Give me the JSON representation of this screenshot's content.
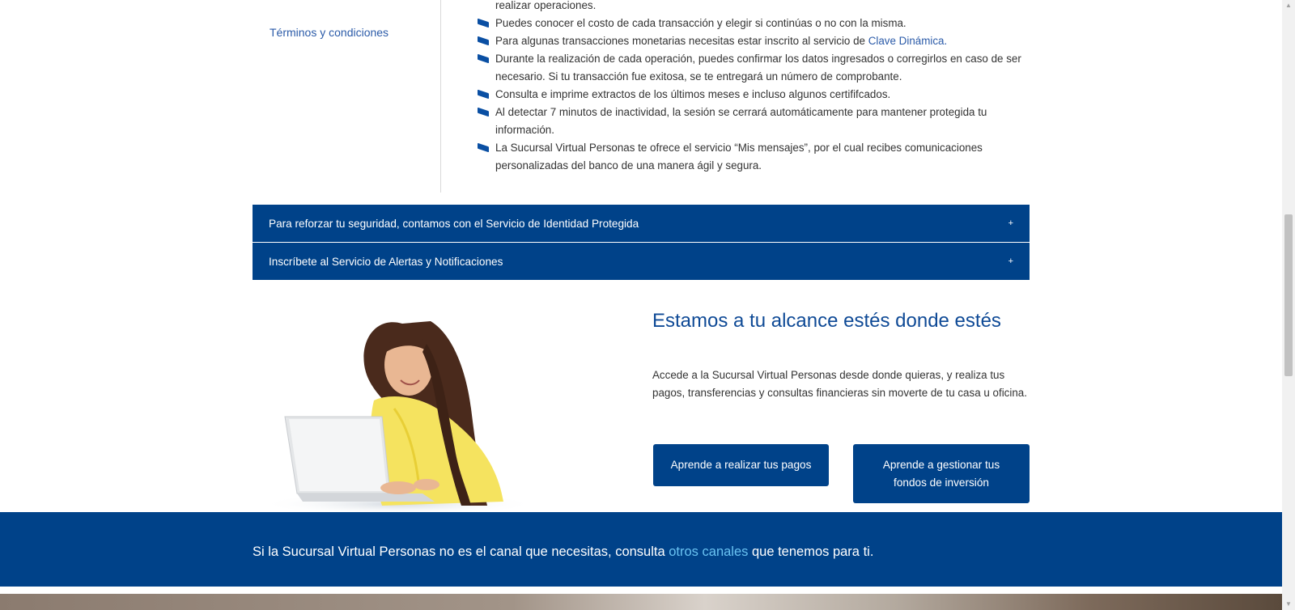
{
  "sidebar": {
    "terms_link": "Términos y condiciones"
  },
  "features": {
    "items": [
      {
        "text": "realizar operaciones."
      },
      {
        "text": "Puedes conocer el costo de cada transacción y elegir si continúas o no con la misma."
      },
      {
        "text_before": "Para algunas transacciones monetarias necesitas estar inscrito  al servicio de ",
        "link": "Clave Dinámica."
      },
      {
        "text": "Durante la realización de cada operación, puedes confirmar los datos ingresados o corregirlos en caso de ser necesario. Si tu transacción fue exitosa, se te entregará un número de comprobante."
      },
      {
        "text": "Consulta e imprime extractos de los últimos meses e incluso algunos certififcados."
      },
      {
        "text": "Al detectar 7 minutos de inactividad, la sesión se cerrará automáticamente para mantener protegida tu información."
      },
      {
        "text": "La Sucursal Virtual Personas te ofrece el servicio “Mis mensajes”, por el cual recibes comunicaciones personalizadas del banco de una manera ágil y segura."
      }
    ]
  },
  "accordions": [
    {
      "label": "Para reforzar tu seguridad, contamos con el Servicio de Identidad Protegida",
      "icon": "+"
    },
    {
      "label": "Inscríbete al Servicio de Alertas y Notificaciones",
      "icon": "+"
    }
  ],
  "hero": {
    "title": "Estamos a tu alcance estés donde estés",
    "text": "Accede a la Sucursal Virtual Personas desde donde quieras, y realiza tus pagos, transferencias y consultas financieras sin moverte de tu casa u oficina.",
    "button_pagos": "Aprende a realizar tus pagos",
    "button_fondos": "Aprende a gestionar tus fondos de inversión"
  },
  "band": {
    "text_before": "Si la Sucursal Virtual Personas no es el canal que necesitas, consulta ",
    "link": "otros canales",
    "text_after": " que tenemos para ti."
  },
  "colors": {
    "brand_blue": "#004289",
    "link_blue": "#2a5aa8",
    "band_link": "#69c2f2"
  }
}
